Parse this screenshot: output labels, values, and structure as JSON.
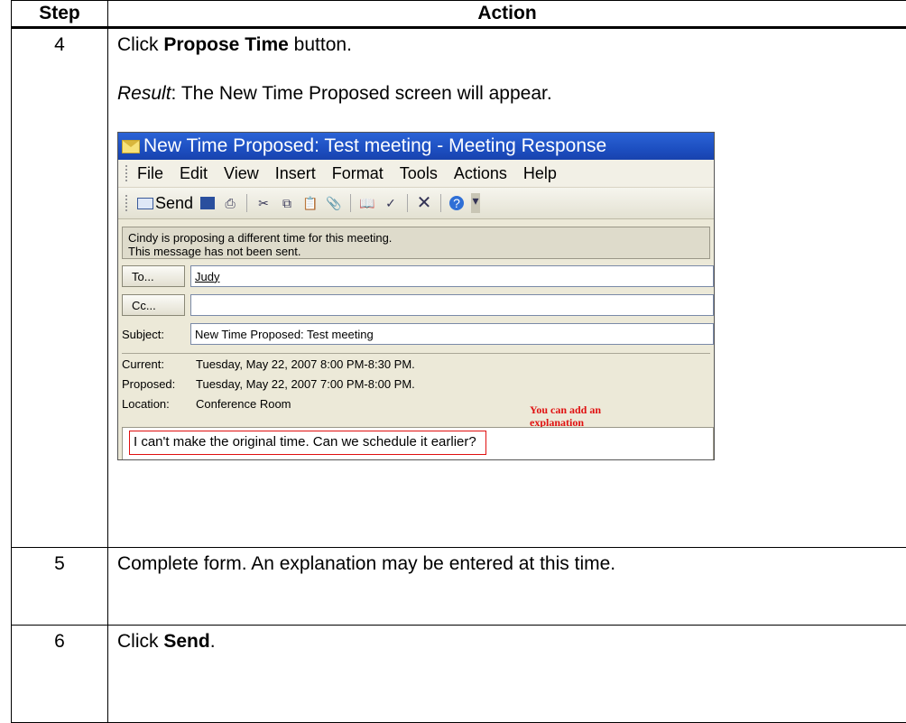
{
  "header": {
    "step": "Step",
    "action": "Action"
  },
  "rows": [
    {
      "num": "4",
      "pre": "Click ",
      "bold": "Propose Time",
      "post": " button.",
      "result_label": "Result",
      "result_text": ":  The New Time Proposed screen will appear."
    },
    {
      "num": "5",
      "text": "Complete form.  An explanation may be entered at this time."
    },
    {
      "num": "6",
      "pre": "Click ",
      "bold": "Send",
      "post": "."
    }
  ],
  "screenshot": {
    "title": "New Time Proposed: Test meeting - Meeting Response",
    "menu": [
      "File",
      "Edit",
      "View",
      "Insert",
      "Format",
      "Tools",
      "Actions",
      "Help"
    ],
    "send_label": "Send",
    "info_line1": "Cindy is proposing a different time for this meeting.",
    "info_line2": "This message has not been sent.",
    "to_button": "To...",
    "to_value": "Judy",
    "cc_button": "Cc...",
    "cc_value": "",
    "subject_label": "Subject:",
    "subject_value": "New Time Proposed: Test meeting",
    "current_label": "Current:",
    "current_value": "Tuesday, May 22, 2007 8:00 PM-8:30 PM.",
    "proposed_label": "Proposed:",
    "proposed_value": "Tuesday, May 22, 2007 7:00 PM-8:00 PM.",
    "location_label": "Location:",
    "location_value": "Conference Room",
    "note_line1": "You can add an",
    "note_line2": "explanation",
    "body_text": "I can't make the original time.  Can we schedule it earlier?"
  }
}
